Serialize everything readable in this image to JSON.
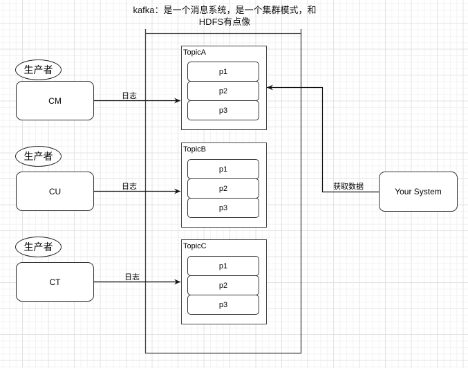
{
  "title": "kafka：是一个消息系统，是一个集群模式，和HDFS有点像",
  "producers": [
    {
      "role": "生产者",
      "name": "CM",
      "edge_label": "日志"
    },
    {
      "role": "生产者",
      "name": "CU",
      "edge_label": "日志"
    },
    {
      "role": "生产者",
      "name": "CT",
      "edge_label": "日志"
    }
  ],
  "topics": [
    {
      "name": "TopicA",
      "partitions": [
        "p1",
        "p2",
        "p3"
      ]
    },
    {
      "name": "TopicB",
      "partitions": [
        "p1",
        "p2",
        "p3"
      ]
    },
    {
      "name": "TopicC",
      "partitions": [
        "p1",
        "p2",
        "p3"
      ]
    }
  ],
  "consumer": {
    "name": "Your System",
    "edge_label": "获取数据",
    "target": "TopicA"
  },
  "colors": {
    "stroke": "#333333",
    "grid_major": "#e3e3e3",
    "grid_minor": "#f3f3f3",
    "background": "#ffffff"
  }
}
